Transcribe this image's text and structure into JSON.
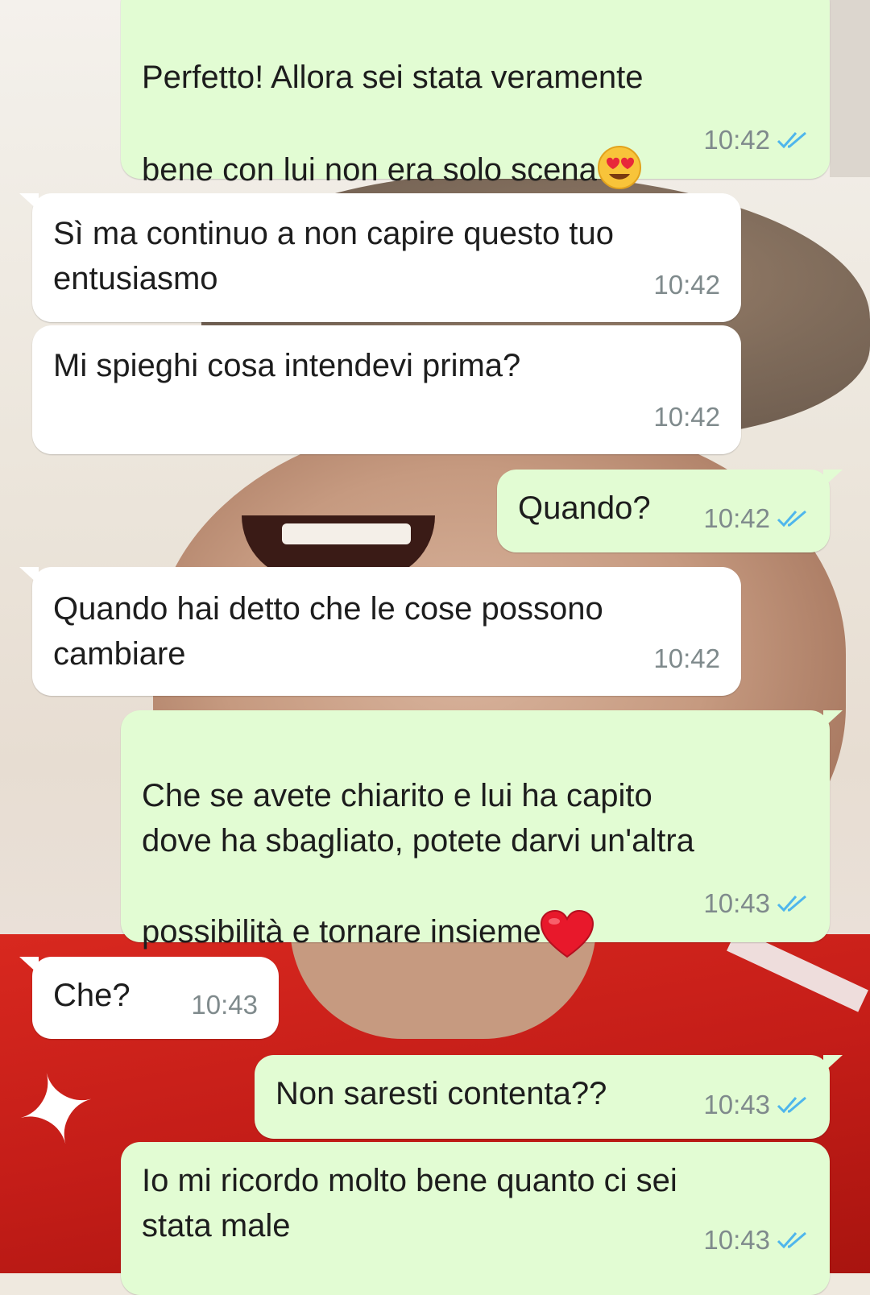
{
  "chat": {
    "messages": [
      {
        "id": "m1",
        "direction": "outgoing",
        "text": "Perfetto! Allora sei stata veramente\nbene con lui non era solo scena",
        "emoji": "heart-eyes-emoji",
        "time": "10:42",
        "status": "read"
      },
      {
        "id": "m2",
        "direction": "incoming",
        "text": "Sì ma continuo a non capire questo tuo\nentusiasmo",
        "time": "10:42"
      },
      {
        "id": "m3",
        "direction": "incoming",
        "text": "Mi spieghi cosa intendevi prima?",
        "time": "10:42"
      },
      {
        "id": "m4",
        "direction": "outgoing",
        "text": "Quando?",
        "time": "10:42",
        "status": "read"
      },
      {
        "id": "m5",
        "direction": "incoming",
        "text": "Quando hai detto che le cose possono\ncambiare",
        "time": "10:42"
      },
      {
        "id": "m6",
        "direction": "outgoing",
        "text": "Che se avete chiarito e lui ha capito\ndove ha sbagliato, potete darvi un'altra\npossibilità e tornare insieme",
        "emoji": "red-heart-emoji",
        "time": "10:43",
        "status": "read"
      },
      {
        "id": "m7",
        "direction": "incoming",
        "text": "Che?",
        "time": "10:43"
      },
      {
        "id": "m8",
        "direction": "outgoing",
        "text": "Non saresti contenta??",
        "time": "10:43",
        "status": "read"
      },
      {
        "id": "m9",
        "direction": "outgoing",
        "text": "Io mi ricordo molto bene quanto ci sei\nstata male",
        "time": "10:43",
        "status": "read"
      }
    ]
  },
  "colors": {
    "outgoing_bubble": "#e2fcd3",
    "incoming_bubble": "#ffffff",
    "read_ticks": "#4fb6ec",
    "timestamp": "#7f8a8c"
  }
}
